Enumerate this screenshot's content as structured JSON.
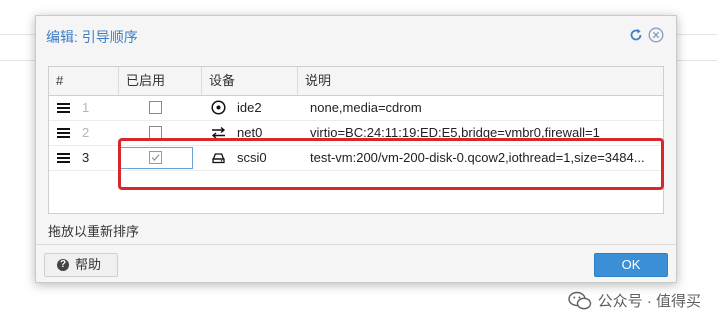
{
  "dialog": {
    "title": "编辑: 引导顺序",
    "tools": {
      "reset_icon": "reset-icon",
      "close_icon": "close-icon"
    }
  },
  "grid": {
    "columns": [
      "#",
      "已启用",
      "设备",
      "说明"
    ],
    "rows": [
      {
        "order": "1",
        "enabled": false,
        "device_icon": "disc-icon",
        "device": "ide2",
        "description": "none,media=cdrom"
      },
      {
        "order": "2",
        "enabled": false,
        "device_icon": "network-icon",
        "device": "net0",
        "description": "virtio=BC:24:11:19:ED:E5,bridge=vmbr0,firewall=1"
      },
      {
        "order": "3",
        "enabled": true,
        "device_icon": "harddisk-icon",
        "device": "scsi0",
        "description": "test-vm:200/vm-200-disk-0.qcow2,iothread=1,size=3484..."
      }
    ]
  },
  "hint": "拖放以重新排序",
  "buttons": {
    "help": "帮助",
    "ok": "OK"
  },
  "watermark": "公众号 · 值得买",
  "colors": {
    "title": "#3f7ec5",
    "ok_button": "#3a8fd6",
    "highlight": "#d6282b"
  }
}
